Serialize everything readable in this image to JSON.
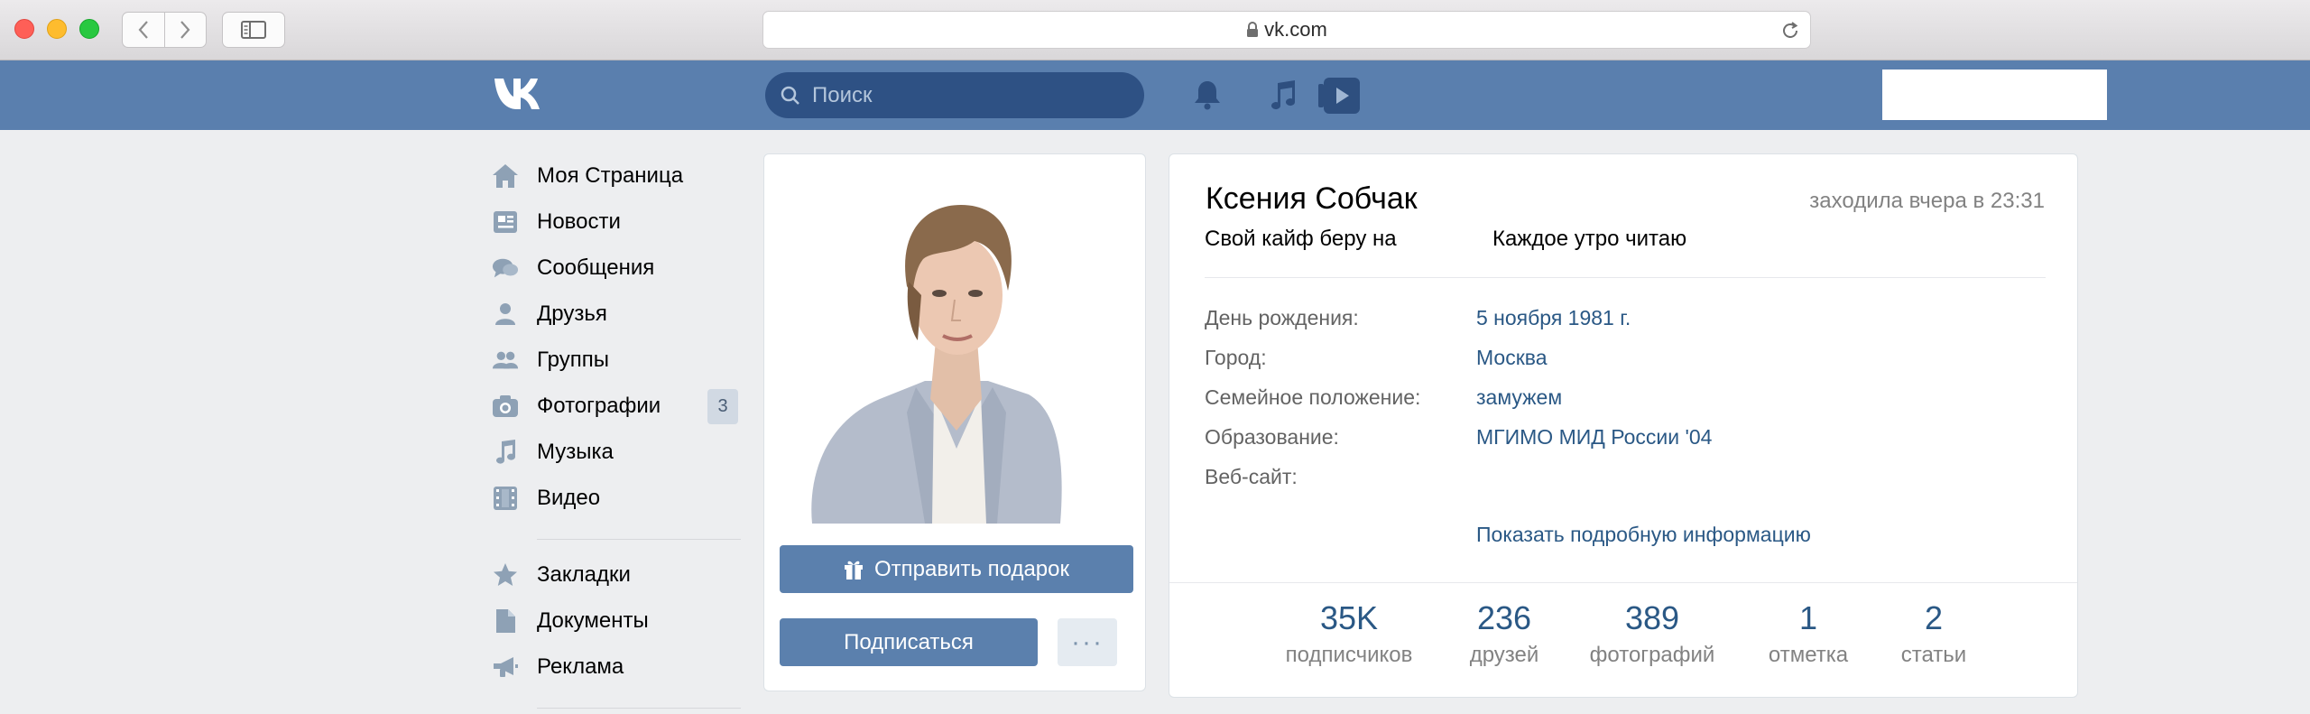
{
  "browser": {
    "url": "vk.com"
  },
  "header": {
    "search_placeholder": "Поиск"
  },
  "menu": {
    "items": [
      {
        "label": "Моя Страница"
      },
      {
        "label": "Новости"
      },
      {
        "label": "Сообщения"
      },
      {
        "label": "Друзья"
      },
      {
        "label": "Группы"
      },
      {
        "label": "Фотографии",
        "badge": "3"
      },
      {
        "label": "Музыка"
      },
      {
        "label": "Видео"
      },
      {
        "label": "Закладки"
      },
      {
        "label": "Документы"
      },
      {
        "label": "Реклама"
      }
    ]
  },
  "photo_card": {
    "gift_button": "Отправить подарок",
    "subscribe_button": "Подписаться",
    "more_button": "···"
  },
  "profile": {
    "name": "Ксения Собчак",
    "last_seen": "заходила вчера в 23:31",
    "status_part1": "Свой кайф беру на",
    "status_part2": "Каждое утро читаю",
    "fields": [
      {
        "label": "День рождения:",
        "value": "5 ноября 1981 г."
      },
      {
        "label": "Город:",
        "value": "Москва"
      },
      {
        "label": "Семейное положение:",
        "value": "замужем"
      },
      {
        "label": "Образование:",
        "value": "МГИМО МИД России '04"
      },
      {
        "label": "Веб-сайт:",
        "value": ""
      }
    ],
    "show_more": "Показать подробную информацию",
    "stats": [
      {
        "num": "35K",
        "label": "подписчиков"
      },
      {
        "num": "236",
        "label": "друзей"
      },
      {
        "num": "389",
        "label": "фотографий"
      },
      {
        "num": "1",
        "label": "отметка"
      },
      {
        "num": "2",
        "label": "статьи"
      }
    ]
  },
  "colors": {
    "header": "#5a7fae",
    "button": "#5b80ad",
    "link": "#2a5885",
    "page_bg": "#edeef0"
  }
}
